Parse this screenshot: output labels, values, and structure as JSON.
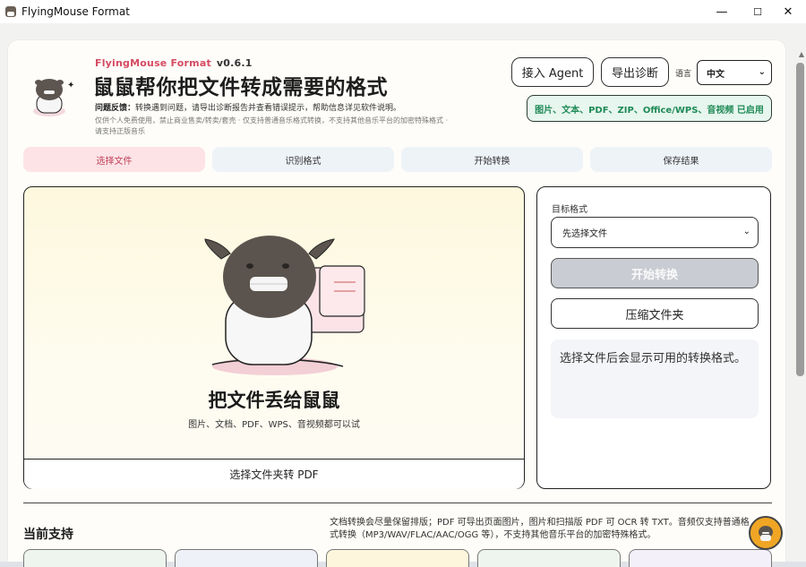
{
  "window": {
    "title": "FlyingMouse Format",
    "controls": {
      "minimize": "—",
      "maximize": "☐",
      "close": "✕"
    }
  },
  "header": {
    "brand": "FlyingMouse Format",
    "version": "v0.6.1",
    "headline": "鼠鼠帮你把文件转成需要的格式",
    "feedback_label": "问题反馈：",
    "feedback_text": "转换遇到问题，请导出诊断报告并查看错误提示，帮助信息详见软件说明。",
    "notice": "仅供个人免费使用，禁止商业售卖/转卖/套壳 · 仅支持普通音乐格式转换，不支持其他音乐平台的加密特殊格式 · 请支持正版音乐"
  },
  "actions": {
    "agent": "接入 Agent",
    "diagnostics": "导出诊断",
    "language_label": "语言",
    "language_value": "中文",
    "enabled_badge": "图片、文本、PDF、ZIP、Office/WPS、音视频 已启用"
  },
  "steps": [
    {
      "label": "选择文件"
    },
    {
      "label": "识别格式"
    },
    {
      "label": "开始转换"
    },
    {
      "label": "保存结果"
    }
  ],
  "dropzone": {
    "title": "把文件丢给鼠鼠",
    "subtitle": "图片、文档、PDF、WPS、音视频都可以试",
    "folder_button": "选择文件夹转 PDF"
  },
  "side": {
    "target_label": "目标格式",
    "target_placeholder": "先选择文件",
    "start_button": "开始转换",
    "zip_button": "压缩文件夹",
    "hint": "选择文件后会显示可用的转换格式。"
  },
  "support": {
    "title": "当前支持",
    "note": "文档转换会尽量保留排版；PDF 可导出页面图片，图片和扫描版 PDF 可 OCR 转 TXT。音频仅支持普通格式转换（MP3/WAV/FLAC/AAC/OGG 等），不支持其他音乐平台的加密特殊格式。"
  },
  "colors": {
    "brand_pink": "#d64b63",
    "enabled_green": "#1f8a57",
    "accent_orange": "#f0a624"
  }
}
